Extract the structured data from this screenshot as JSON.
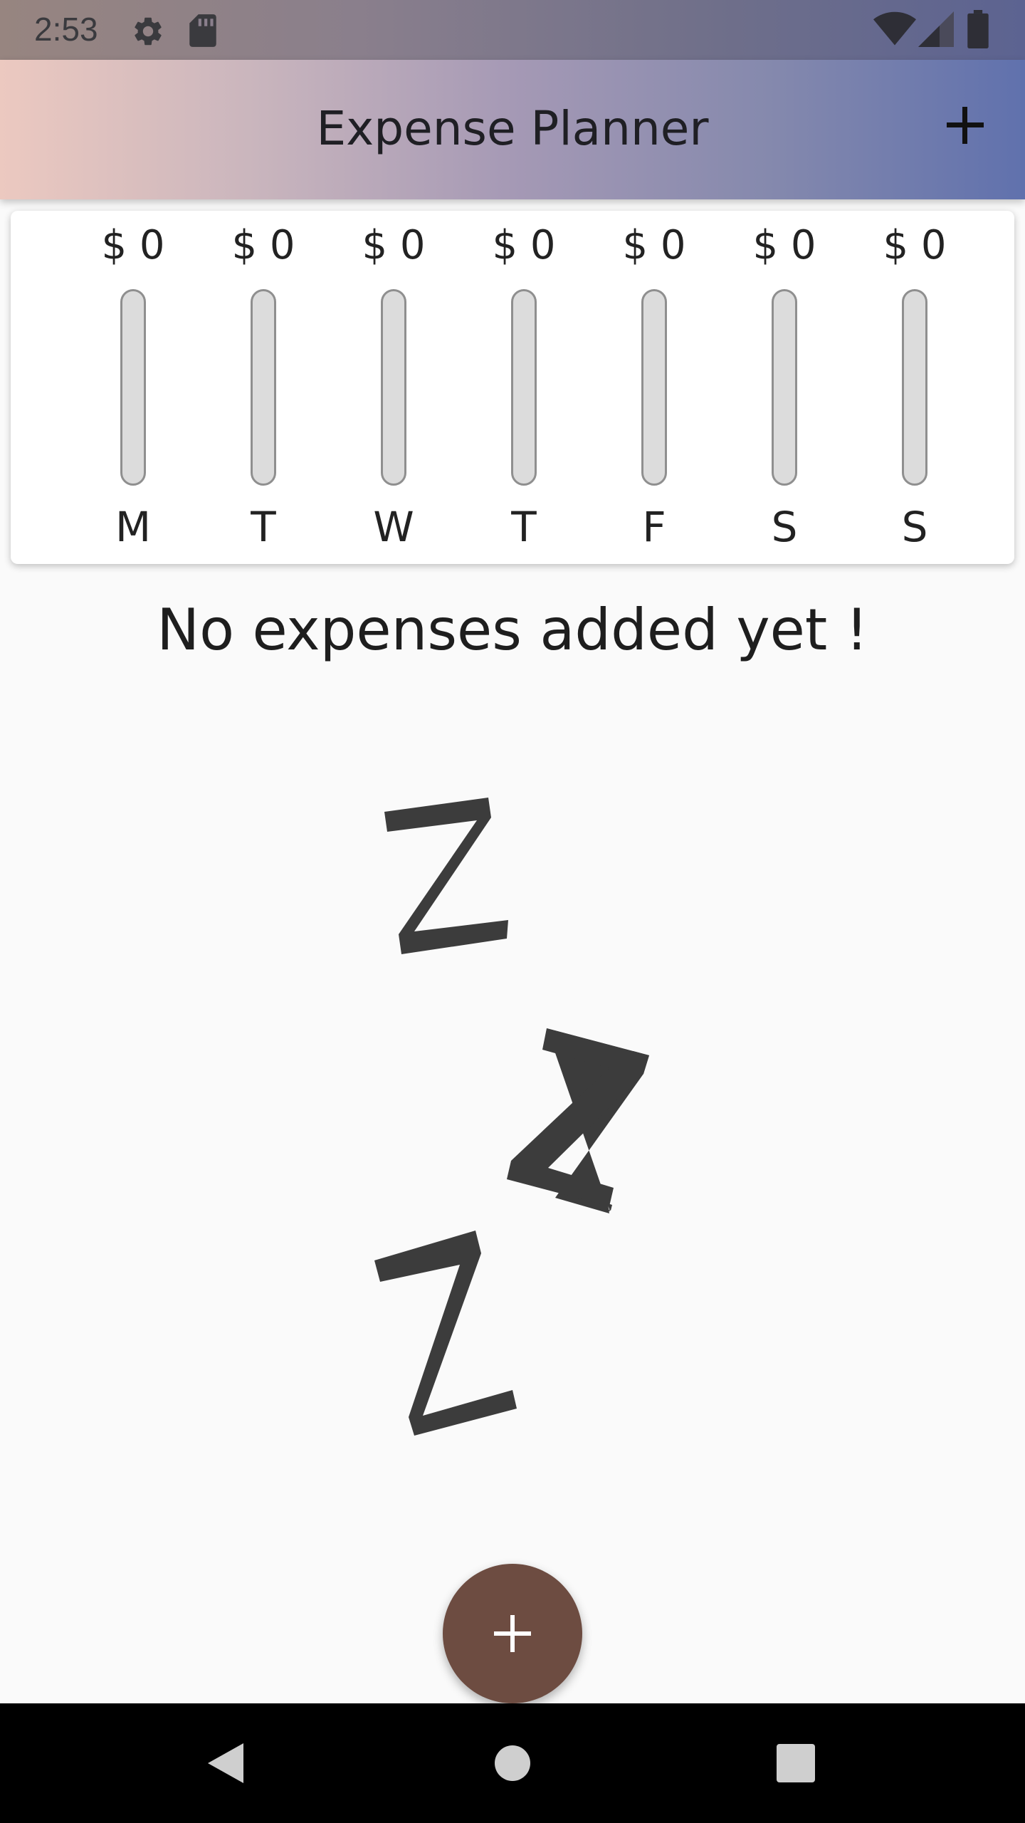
{
  "status_bar": {
    "time": "2:53",
    "icons": [
      "gear-icon",
      "sd-card-icon",
      "wifi-icon",
      "cell-signal-icon",
      "battery-icon"
    ]
  },
  "app_bar": {
    "title": "Expense Planner",
    "add_icon": "plus-icon"
  },
  "chart_data": {
    "type": "bar",
    "categories": [
      "M",
      "T",
      "W",
      "T",
      "F",
      "S",
      "S"
    ],
    "values": [
      0,
      0,
      0,
      0,
      0,
      0,
      0
    ],
    "amount_labels": [
      "$ 0",
      "$ 0",
      "$ 0",
      "$ 0",
      "$ 0",
      "$ 0",
      "$ 0"
    ],
    "colors": {
      "track": "#dcdcdc",
      "border": "#8f8f8f",
      "fill": "#6d4c41"
    }
  },
  "empty_state": {
    "message": "No expenses added yet !",
    "image_icon": "sleeping-zzz-icon"
  },
  "fab": {
    "icon": "plus-icon",
    "color": "#6d4c41"
  },
  "nav_bar": {
    "icons": [
      "back-icon",
      "home-icon",
      "recents-icon"
    ]
  }
}
